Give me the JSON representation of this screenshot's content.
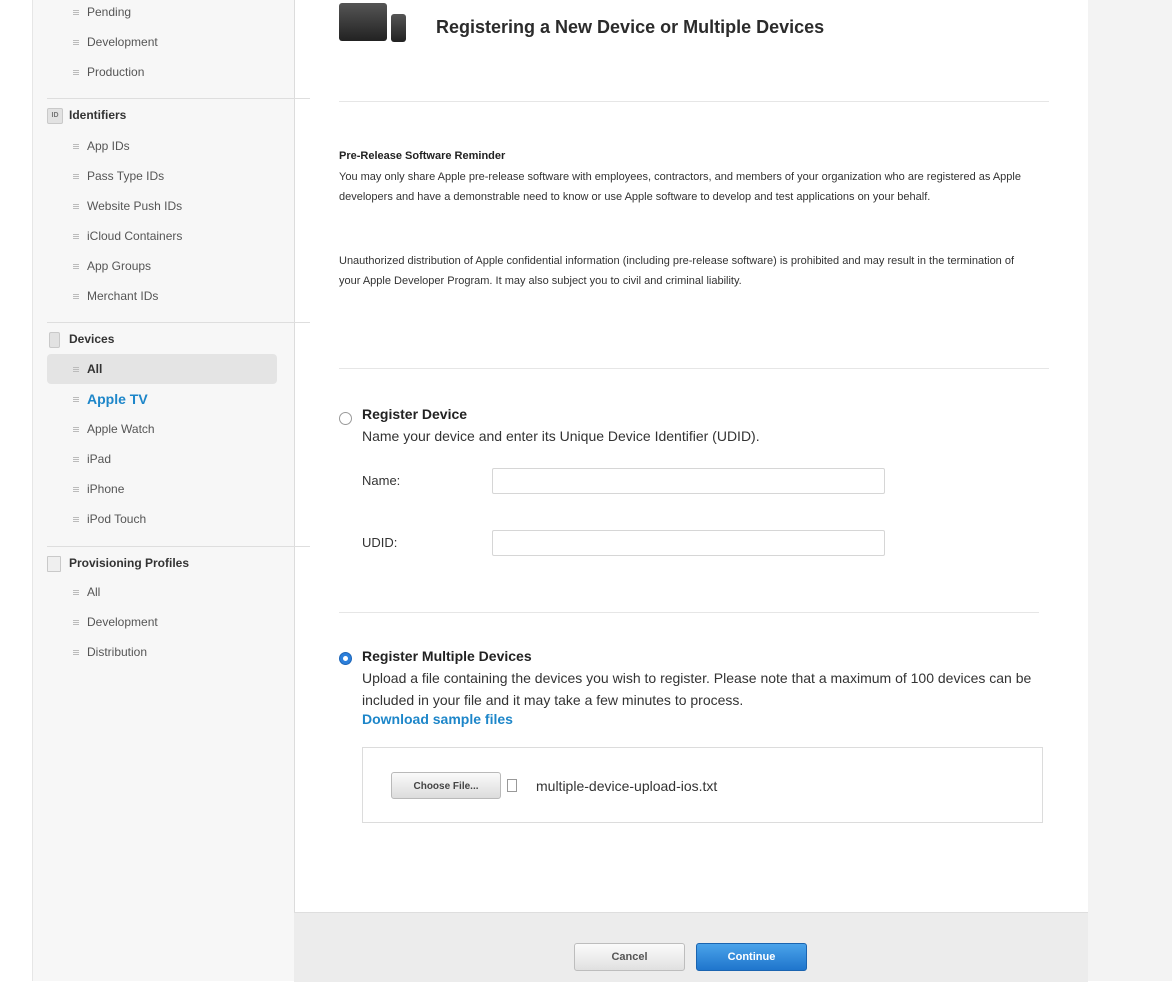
{
  "sidebar": {
    "certificates_items": [
      {
        "label": "Pending"
      },
      {
        "label": "Development"
      },
      {
        "label": "Production"
      }
    ],
    "identifiers": {
      "icon": "id-icon",
      "icon_text": "ID",
      "label": "Identifiers",
      "items": [
        {
          "label": "App IDs"
        },
        {
          "label": "Pass Type IDs"
        },
        {
          "label": "Website Push IDs"
        },
        {
          "label": "iCloud Containers"
        },
        {
          "label": "App Groups"
        },
        {
          "label": "Merchant IDs"
        }
      ]
    },
    "devices": {
      "icon": "phone-icon",
      "label": "Devices",
      "items": [
        {
          "label": "All",
          "state": "selected"
        },
        {
          "label": "Apple TV",
          "state": "hover-link"
        },
        {
          "label": "Apple Watch"
        },
        {
          "label": "iPad"
        },
        {
          "label": "iPhone"
        },
        {
          "label": "iPod Touch"
        }
      ]
    },
    "provisioning": {
      "icon": "document-icon",
      "label": "Provisioning Profiles",
      "items": [
        {
          "label": "All"
        },
        {
          "label": "Development"
        },
        {
          "label": "Distribution"
        }
      ]
    }
  },
  "header": {
    "title": "Registering a New Device or Multiple Devices",
    "icon": "devices-icon"
  },
  "reminder": {
    "title": "Pre-Release Software Reminder",
    "para1": "You may only share Apple pre-release software with employees, contractors, and members of your organization who are registered as Apple developers and have a demonstrable need to know or use Apple software to develop and test applications on your behalf.",
    "para2": "Unauthorized distribution of Apple confidential information (including pre-release software) is prohibited and may result in the termination of your Apple Developer Program. It may also subject you to civil and criminal liability."
  },
  "register_device": {
    "title": "Register Device",
    "description": "Name your device and enter its Unique Device Identifier (UDID).",
    "selected": false,
    "name_label": "Name:",
    "name_value": "",
    "udid_label": "UDID:",
    "udid_value": ""
  },
  "register_multiple": {
    "title": "Register Multiple Devices",
    "selected": true,
    "description": "Upload a file containing the devices you wish to register. Please note that a maximum of 100 devices can be included in your file and it may take a few minutes to process.",
    "sample_link": "Download sample files",
    "choose_label": "Choose File...",
    "file_name": "multiple-device-upload-ios.txt"
  },
  "footer": {
    "cancel_label": "Cancel",
    "continue_label": "Continue"
  },
  "colors": {
    "accent": "#1d86c9",
    "primary_button": "#2b7fdb"
  }
}
